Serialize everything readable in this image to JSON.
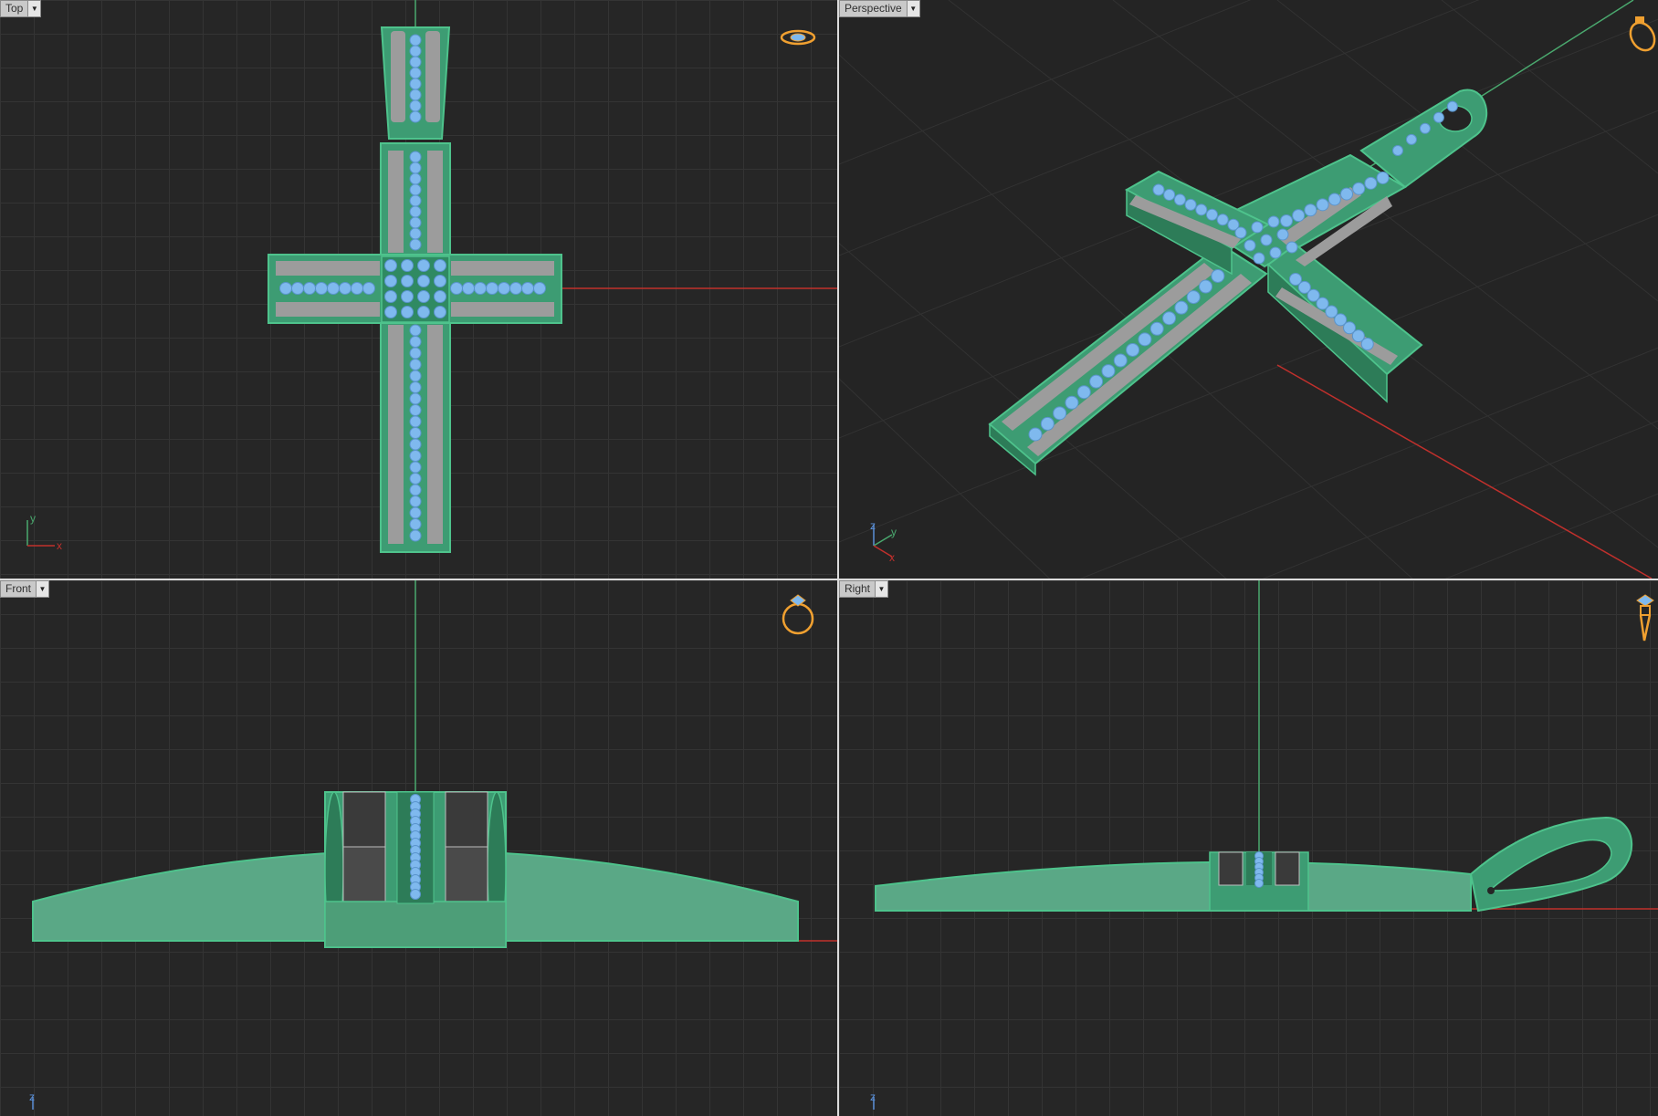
{
  "viewports": {
    "top": {
      "label": "Top",
      "axes": {
        "x": "x",
        "y": "y"
      }
    },
    "perspective": {
      "label": "Perspective",
      "axes": {
        "x": "x",
        "y": "y",
        "z": "z"
      }
    },
    "front": {
      "label": "Front",
      "axes": {
        "z": "z"
      }
    },
    "right": {
      "label": "Right",
      "axes": {
        "z": "z"
      }
    }
  },
  "colors": {
    "background": "#262626",
    "grid": "#343434",
    "model_fill": "#3d9c73",
    "model_edge": "#4ec38c",
    "stone": "#7fb9ee",
    "metal": "#9c9c9c",
    "x_axis": "#c0302c",
    "y_axis": "#4aa86e",
    "nav_icon": "#f0a030"
  },
  "icons": {
    "viewport_dropdown": "chevron-down-icon",
    "view_orientation": "ring-icon"
  }
}
